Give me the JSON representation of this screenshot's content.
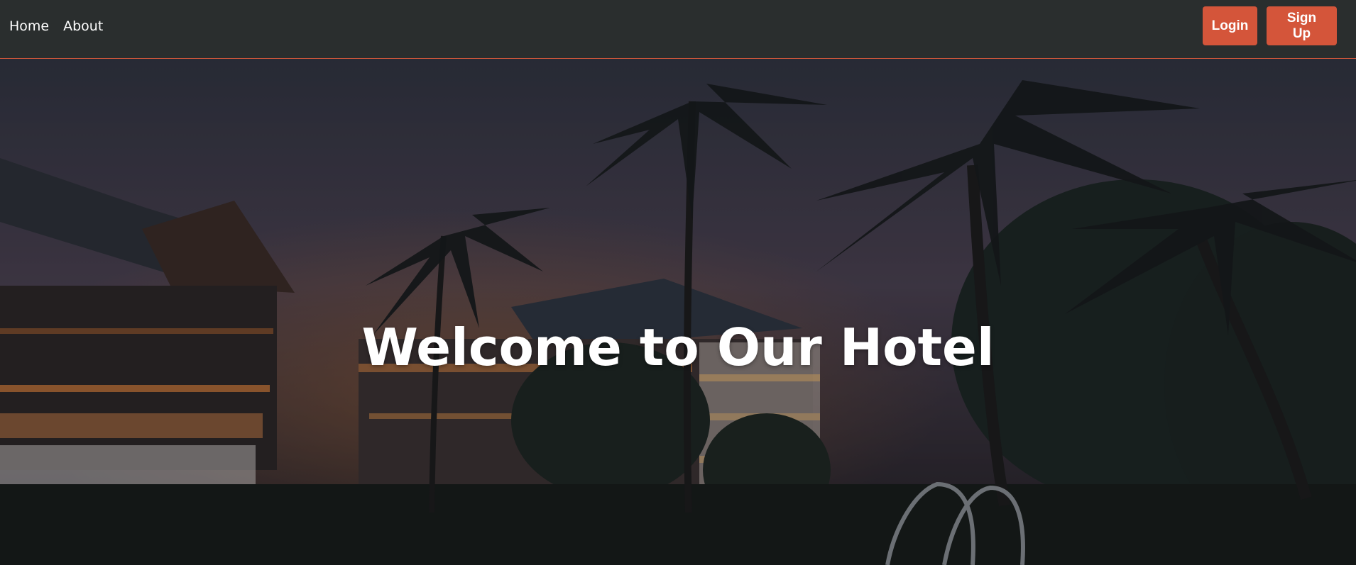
{
  "nav": {
    "links": [
      {
        "label": "Home"
      },
      {
        "label": "About"
      }
    ],
    "actions": {
      "login_label": "Login",
      "signup_label": "Sign Up"
    }
  },
  "hero": {
    "title": "Welcome to Our Hotel",
    "background_image": "night hotel resort with palm trees and lit balconies"
  },
  "colors": {
    "navbar_bg": "#2a2e2e",
    "accent": "#d4553a",
    "hero_overlay": "#1f1f25"
  }
}
